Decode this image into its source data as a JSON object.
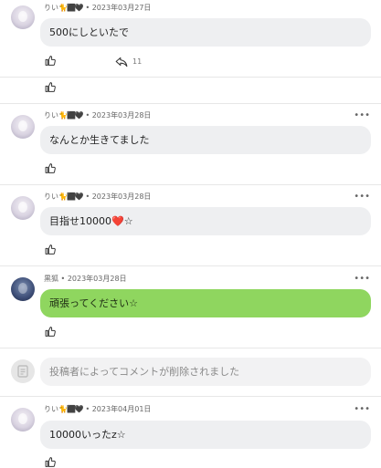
{
  "comments": [
    {
      "author": "りい",
      "emojis": "🐈⬛🖤",
      "date": "2023年03月27日",
      "text": "500にしといたで",
      "share_count": "11"
    },
    {
      "author": "りい",
      "emojis": "🐈⬛🖤",
      "date": "2023年03月28日",
      "text": "なんとか生きてました"
    },
    {
      "author": "りい",
      "emojis": "🐈⬛🖤",
      "date": "2023年03月28日",
      "text": "目指せ10000❤️☆"
    },
    {
      "author": "黒狐",
      "date": "2023年03月28日",
      "text": "頑張ってください☆",
      "bubble_color": "#8fd65f"
    },
    {
      "deleted_text": "投稿者によってコメントが削除されました"
    },
    {
      "author": "りい",
      "emojis": "🐈⬛🖤",
      "date": "2023年04月01日",
      "text": "10000いったz☆"
    }
  ],
  "separator": "•",
  "more_label": "•••",
  "icons": {
    "like": "thumbs-up-icon",
    "share": "share-arrow-icon",
    "more": "more-dots-icon",
    "avatar": "avatar"
  }
}
